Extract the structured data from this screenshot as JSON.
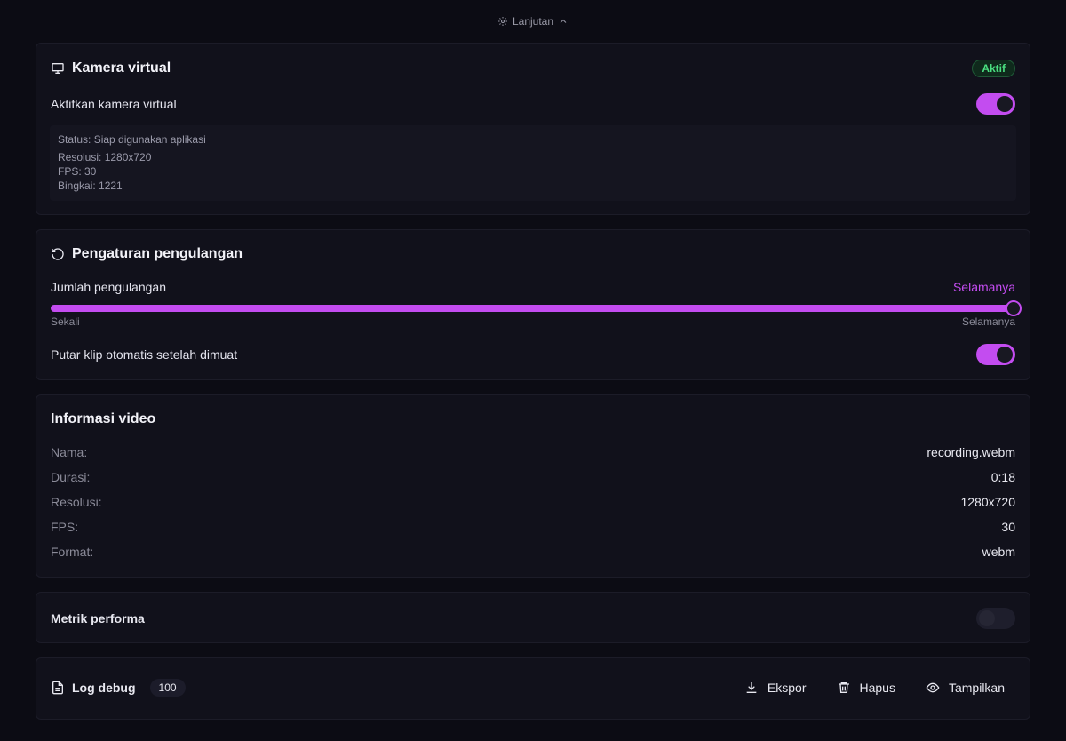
{
  "topbar": {
    "label": "Lanjutan",
    "icon": "gear-icon"
  },
  "virtual_camera": {
    "title": "Kamera virtual",
    "badge": "Aktif",
    "toggle_label": "Aktifkan kamera virtual",
    "toggle_on": true,
    "status": "Status: Siap digunakan aplikasi",
    "resolution": "Resolusi: 1280x720",
    "fps": "FPS: 30",
    "frames": "Bingkai: 1221"
  },
  "loop_settings": {
    "title": "Pengaturan pengulangan",
    "count_label": "Jumlah pengulangan",
    "count_value": "Selamanya",
    "slider_min_label": "Sekali",
    "slider_max_label": "Selamanya",
    "slider_level": 1.0,
    "autoplay_label": "Putar klip otomatis setelah dimuat",
    "autoplay_on": true
  },
  "video_info": {
    "title": "Informasi video",
    "rows": [
      {
        "key": "Nama:",
        "value": "recording.webm"
      },
      {
        "key": "Durasi:",
        "value": "0:18"
      },
      {
        "key": "Resolusi:",
        "value": "1280x720"
      },
      {
        "key": "FPS:",
        "value": "30"
      },
      {
        "key": "Format:",
        "value": "webm"
      }
    ]
  },
  "performance": {
    "title": "Metrik performa",
    "toggle_on": false
  },
  "debug_log": {
    "title": "Log debug",
    "count": "100",
    "export_label": "Ekspor",
    "clear_label": "Hapus",
    "show_label": "Tampilkan"
  },
  "colors": {
    "accent": "#c34cf0",
    "success": "#4ade80",
    "background": "#0c0c14",
    "card": "#11111b"
  }
}
